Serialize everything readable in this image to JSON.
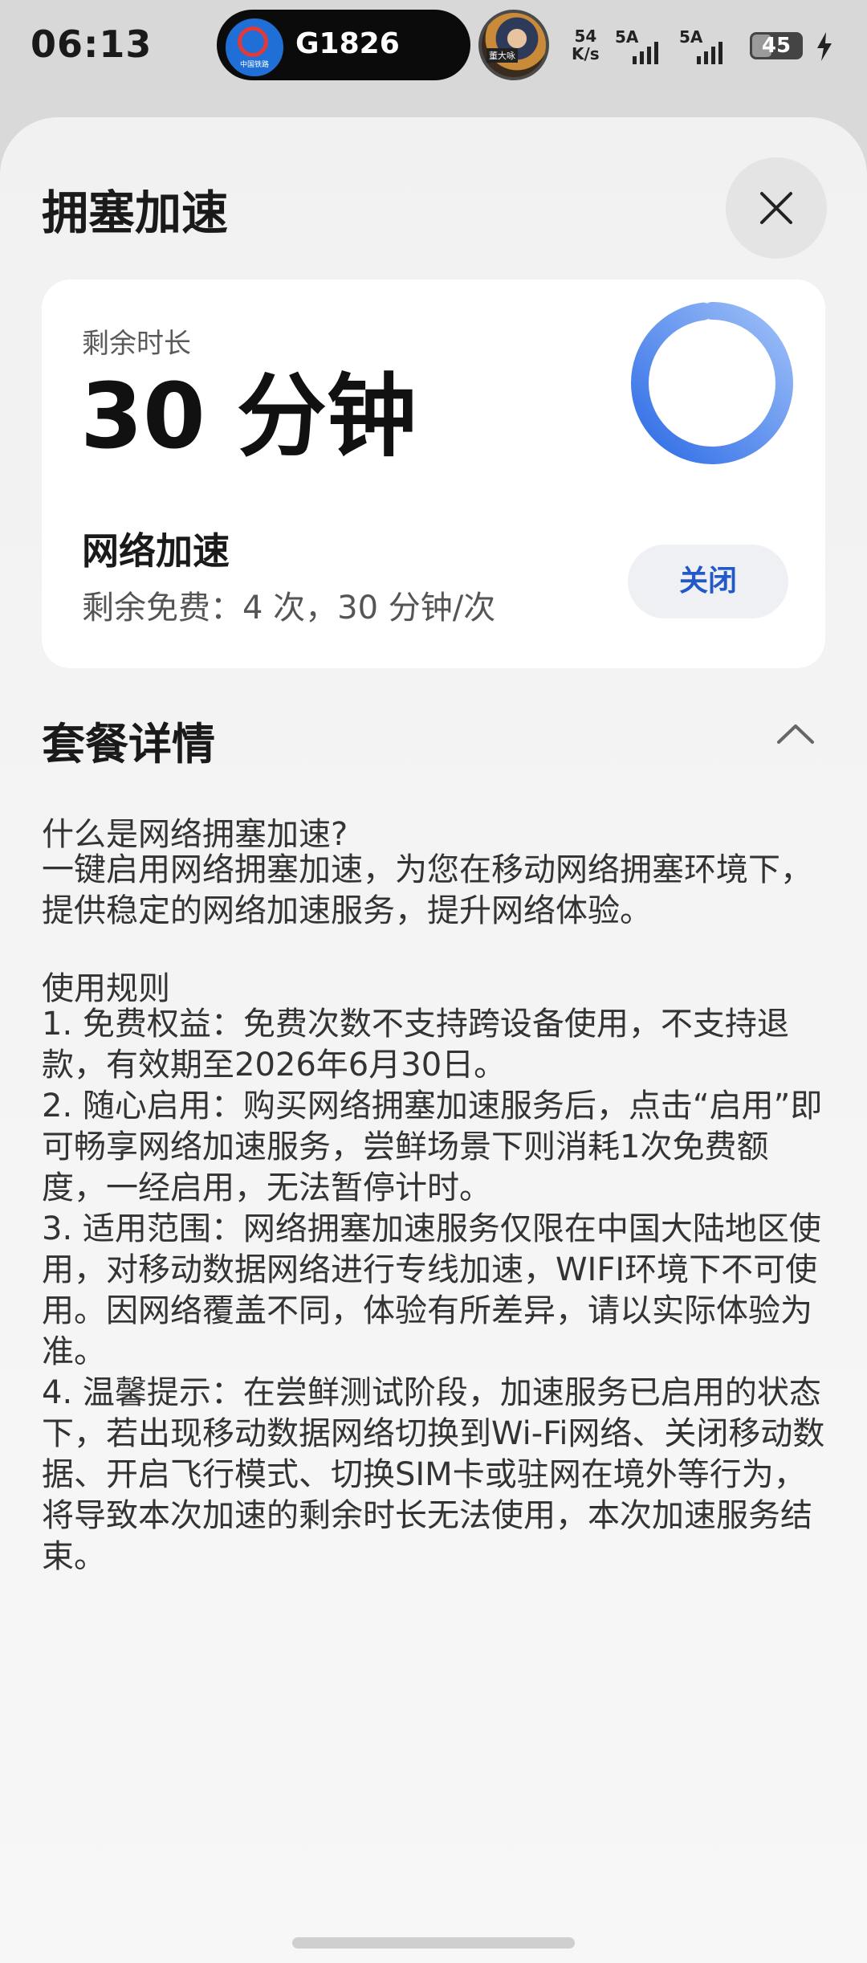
{
  "status_bar": {
    "time": "06:13",
    "live_activity": {
      "app_logo_text": "中国铁路",
      "train_number": "G1826"
    },
    "avatar_badge": "董大咏",
    "net_speed_value": "54",
    "net_speed_unit": "K/s",
    "signal_1_label": "5A",
    "signal_2_label": "5A",
    "battery_level": "45",
    "charging_icon": "bolt-icon"
  },
  "sheet": {
    "title": "拥塞加速",
    "close_icon": "close-icon"
  },
  "card": {
    "remain_label": "剩余时长",
    "remain_value": "30 分钟",
    "gauge_progress": 0.98,
    "service_title": "网络加速",
    "free_remaining": "剩余免费：4 次，30 分钟/次",
    "off_button": "关闭",
    "accent_color": "#2f6de6"
  },
  "details": {
    "title": "套餐详情",
    "chevron_icon": "chevron-up-icon",
    "q1_title": "什么是网络拥塞加速?",
    "q1_body": "一键启用网络拥塞加速，为您在移动网络拥塞环境下，提供稳定的网络加速服务，提升网络体验。",
    "rules_title": "使用规则",
    "rules": [
      "1. 免费权益：免费次数不支持跨设备使用，不支持退款，有效期至2026年6月30日。",
      "2. 随心启用：购买网络拥塞加速服务后，点击“启用”即可畅享网络加速服务，尝鲜场景下则消耗1次免费额度，一经启用，无法暂停计时。",
      "3. 适用范围：网络拥塞加速服务仅限在中国大陆地区使用，对移动数据网络进行专线加速，WIFI环境下不可使用。因网络覆盖不同，体验有所差异，请以实际体验为准。",
      "4. 温馨提示：在尝鲜测试阶段，加速服务已启用的状态下，若出现移动数据网络切换到Wi-Fi网络、关闭移动数据、开启飞行模式、切换SIM卡或驻网在境外等行为，将导致本次加速的剩余时长无法使用，本次加速服务结束。"
    ]
  }
}
